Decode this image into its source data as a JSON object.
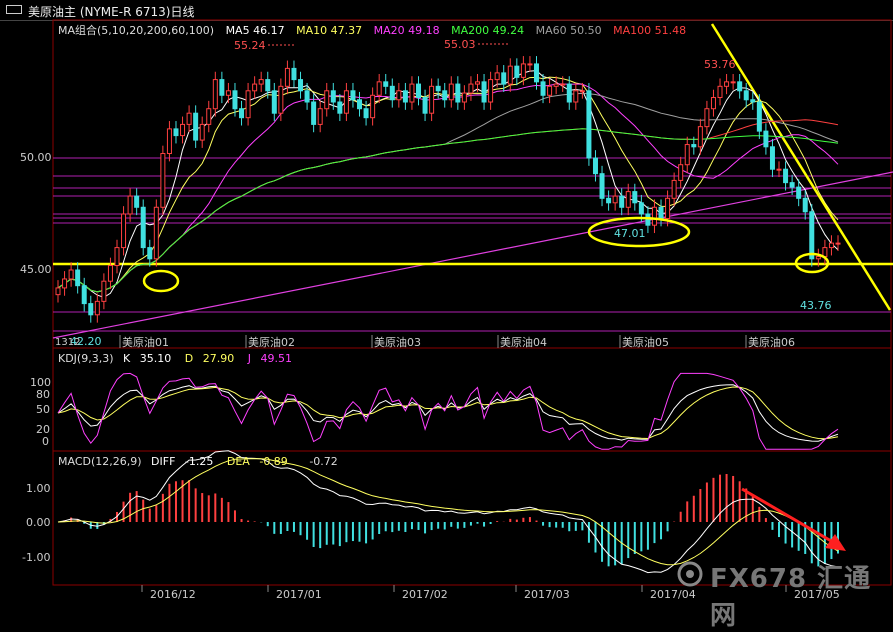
{
  "title": "美原油主 (NYME-R 6713)日线",
  "main_panel": {
    "ma_group_label": "MA组合(5,10,20,200,60,100)",
    "ma_values": [
      {
        "label": "MA5 46.17",
        "color": "#ffffff"
      },
      {
        "label": "MA10 47.37",
        "color": "#ffff60"
      },
      {
        "label": "MA20 49.18",
        "color": "#ff40ff"
      },
      {
        "label": "MA200 49.24",
        "color": "#40ff40"
      },
      {
        "label": "MA60 50.50",
        "color": "#a0a0a0"
      },
      {
        "label": "MA100 51.48",
        "color": "#ff4040"
      }
    ],
    "y_tick_labels": [
      "50.00",
      "45.00"
    ],
    "contract_labels": [
      "美原油01",
      "美原油02",
      "美原油03",
      "美原油04",
      "美原油05",
      "美原油06"
    ],
    "annotations": {
      "high1": "55.24",
      "high2": "55.03",
      "high3": "53.76",
      "low_mid": "47.01",
      "low_recent": "43.76",
      "low_left": "42.20",
      "left_code": "1312"
    }
  },
  "kdj_panel": {
    "label": "KDJ(9,3,3)",
    "k_label": "K",
    "k_value": "35.10",
    "d_label": "D",
    "d_value": "27.90",
    "j_label": "J",
    "j_value": "49.51",
    "y_tick_labels": [
      "100",
      "80",
      "50",
      "20",
      "0"
    ]
  },
  "macd_panel": {
    "label": "MACD(12,26,9)",
    "diff_label": "DIFF",
    "diff_value": "-1.25",
    "dea_label": "DEA",
    "dea_value": "-0.89",
    "macd_value": "-0.72",
    "y_tick_labels": [
      "1.00",
      "0.00",
      "-1.00"
    ]
  },
  "x_axis_labels": [
    "2016/12",
    "2017/01",
    "2017/02",
    "2017/03",
    "2017/04",
    "2017/05"
  ],
  "watermark": "FX678 汇通网",
  "colors": {
    "up": "#ff4040",
    "down": "#40e0e0",
    "support": "#ffff00",
    "grid_magenta": "#c030c0",
    "ma20": "#ff40ff",
    "ma200": "#40ff40",
    "ma100": "#ff4040"
  },
  "chart_data": {
    "type": "candlestick",
    "title": "美原油主 (NYME-R 6713)日线",
    "ylim": [
      42,
      56
    ],
    "close_series": [
      44.2,
      44.6,
      45.0,
      44.3,
      43.5,
      43.0,
      43.6,
      44.5,
      45.2,
      46.0,
      47.5,
      48.3,
      47.8,
      46.0,
      45.5,
      47.8,
      50.2,
      51.3,
      51.0,
      51.5,
      52.0,
      50.8,
      51.5,
      52.2,
      53.5,
      52.8,
      53.0,
      52.2,
      51.8,
      53.0,
      53.3,
      53.5,
      53.0,
      52.0,
      53.2,
      54.0,
      53.5,
      53.0,
      52.5,
      51.5,
      52.2,
      53.0,
      52.5,
      52.0,
      53.0,
      52.6,
      52.2,
      51.8,
      52.8,
      53.4,
      53.2,
      52.6,
      53.0,
      52.5,
      53.3,
      52.7,
      52.0,
      53.2,
      53.0,
      52.6,
      53.3,
      52.5,
      52.9,
      53.3,
      53.4,
      52.5,
      53.5,
      53.8,
      53.3,
      54.1,
      53.6,
      54.2,
      54.2,
      53.4,
      52.8,
      53.2,
      53.3,
      53.3,
      52.5,
      53.0,
      53.0,
      50.0,
      49.3,
      48.2,
      48.0,
      48.3,
      47.8,
      48.5,
      48.0,
      47.5,
      47.0,
      47.8,
      47.3,
      48.2,
      49.0,
      49.7,
      50.6,
      50.5,
      51.4,
      52.2,
      52.7,
      53.2,
      53.4,
      53.4,
      53.0,
      52.6,
      52.5,
      51.2,
      50.5,
      49.5,
      49.5,
      48.9,
      48.7,
      48.2,
      47.6,
      45.5,
      45.6,
      46.0,
      46.2,
      46.2
    ]
  }
}
